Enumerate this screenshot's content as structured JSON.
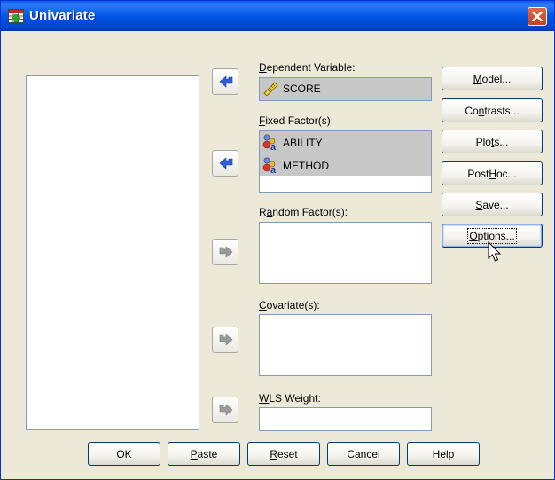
{
  "window": {
    "title": "Univariate",
    "title_icon": "spss-grid-icon",
    "close_icon": "close-x-icon"
  },
  "colors": {
    "titlebar": "#0055e5",
    "dialog_bg": "#ece9d8",
    "selection_bg": "#c7c7c7",
    "arrow_active": "#2f5fd7",
    "arrow_inactive": "#9a9a9a",
    "close_btn": "#c4411f"
  },
  "fields": {
    "dependent": {
      "label_u": "D",
      "label_rest": "ependent Variable:",
      "items": [
        {
          "icon": "scale-ruler-icon",
          "text": "SCORE"
        }
      ]
    },
    "fixed": {
      "label_u": "F",
      "label_rest": "ixed Factor(s):",
      "items": [
        {
          "icon": "nominal-variable-icon",
          "text": "ABILITY"
        },
        {
          "icon": "nominal-variable-icon",
          "text": "METHOD"
        }
      ]
    },
    "random": {
      "label_pre": "R",
      "label_u": "a",
      "label_rest": "ndom Factor(s):"
    },
    "covariate": {
      "label_u": "C",
      "label_rest": "ovariate(s):"
    },
    "wls": {
      "label_u": "W",
      "label_rest": "LS Weight:"
    }
  },
  "side_buttons": {
    "model": {
      "pre": "",
      "u": "M",
      "post": "odel..."
    },
    "contrasts": {
      "pre": "Co",
      "u": "n",
      "post": "trasts..."
    },
    "plots": {
      "pre": "Plo",
      "u": "t",
      "post": "s..."
    },
    "posthoc": {
      "pre": "Post ",
      "u": "H",
      "post": "oc..."
    },
    "save": {
      "pre": "",
      "u": "S",
      "post": "ave..."
    },
    "options": {
      "pre": "",
      "u": "O",
      "post": "ptions..."
    }
  },
  "bottom_buttons": {
    "ok": {
      "pre": "OK",
      "u": "",
      "post": ""
    },
    "paste": {
      "pre": "",
      "u": "P",
      "post": "aste"
    },
    "reset": {
      "pre": "",
      "u": "R",
      "post": "eset"
    },
    "cancel": {
      "pre": "Cancel",
      "u": "",
      "post": ""
    },
    "help": {
      "pre": "Help",
      "u": "",
      "post": ""
    }
  },
  "cursor": "mouse-pointer-icon"
}
